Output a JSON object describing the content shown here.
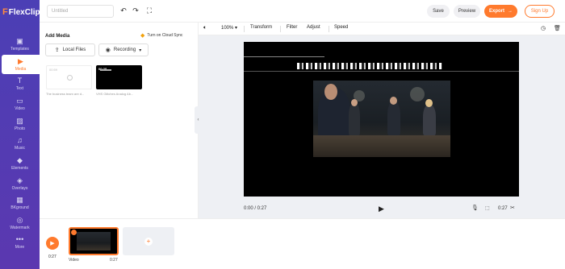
{
  "app": {
    "brand": "FlexClip",
    "project_title_placeholder": "Untitled"
  },
  "sidebar": {
    "items": [
      {
        "label": "Templates",
        "icon": "templates-icon",
        "active": false
      },
      {
        "label": "Media",
        "icon": "media-icon",
        "active": true
      },
      {
        "label": "Text",
        "icon": "text-icon",
        "active": false
      },
      {
        "label": "Video",
        "icon": "video-icon",
        "active": false
      },
      {
        "label": "Photo",
        "icon": "photo-icon",
        "active": false
      },
      {
        "label": "Music",
        "icon": "music-icon",
        "active": false
      },
      {
        "label": "Elements",
        "icon": "elements-icon",
        "active": false
      },
      {
        "label": "Overlays",
        "icon": "overlays-icon",
        "active": false
      },
      {
        "label": "BKground",
        "icon": "background-icon",
        "active": false
      },
      {
        "label": "Watermark",
        "icon": "watermark-icon",
        "active": false
      },
      {
        "label": "More",
        "icon": "more-icon",
        "active": false
      }
    ]
  },
  "topbar": {
    "save_label": "Save",
    "preview_label": "Preview",
    "export_label": "Export",
    "signup_label": "Sign Up"
  },
  "media_panel": {
    "title": "Add Media",
    "cloud_sync_label": "Turn on Cloud Sync",
    "local_files_label": "Local Files",
    "recording_label": "Recording",
    "items": [
      {
        "duration": "00:59",
        "caption": "The business team are d..."
      },
      {
        "duration": "00:28",
        "caption": "VHS Glitches Analog Ab..."
      }
    ]
  },
  "editor_toolbar": {
    "zoom": "100%",
    "transform": "Transform",
    "filter": "Filter",
    "adjust": "Adjust",
    "speed": "Speed"
  },
  "player": {
    "current_time": "0:00 / 0:27",
    "clip_time": "0:27"
  },
  "timeline": {
    "time": "0:27",
    "clip_label": "Video",
    "clip_duration": "0:27"
  },
  "colors": {
    "sidebar": "#4b3fb5",
    "accent": "#ff7a2d",
    "editor_bg": "#eef0f4"
  }
}
